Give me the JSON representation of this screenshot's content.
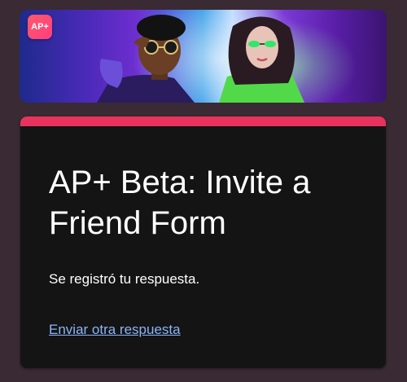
{
  "header": {
    "app_logo_text": "AP+",
    "banner_image": "two-avatars-banner"
  },
  "form": {
    "title": "AP+ Beta: Invite a Friend Form",
    "confirmation": "Se registró tu respuesta.",
    "submit_another_link": "Enviar otra respuesta"
  },
  "colors": {
    "page_background": "#3a2a33",
    "card_background": "#141414",
    "accent": "#e8335e",
    "link": "#8ab4f8"
  }
}
